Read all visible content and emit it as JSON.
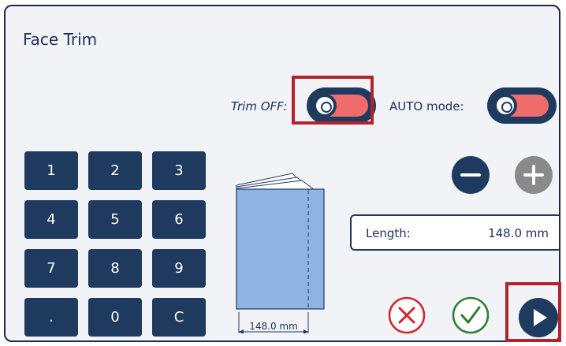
{
  "title": "Face Trim",
  "trim": {
    "label": "Trim OFF:",
    "state": "off"
  },
  "auto_mode": {
    "label": "AUTO mode:",
    "state": "off"
  },
  "keypad": {
    "keys": [
      "1",
      "2",
      "3",
      "4",
      "5",
      "6",
      "7",
      "8",
      "9",
      ".",
      "0",
      "C"
    ]
  },
  "length": {
    "label": "Length:",
    "value": "148.0 mm"
  },
  "book_illustration": {
    "width_label": "148.0 mm"
  },
  "icons": {
    "minus": "minus-icon",
    "plus": "plus-icon",
    "cancel": "x-circle-icon",
    "ok": "check-circle-icon",
    "run": "play-icon"
  },
  "colors": {
    "primary": "#1f3a5f",
    "toggle_off": "#f06b6b",
    "cancel": "#d6232f",
    "ok": "#2f7d32",
    "disabled": "#8a8a8a",
    "highlight": "#b3232e"
  }
}
